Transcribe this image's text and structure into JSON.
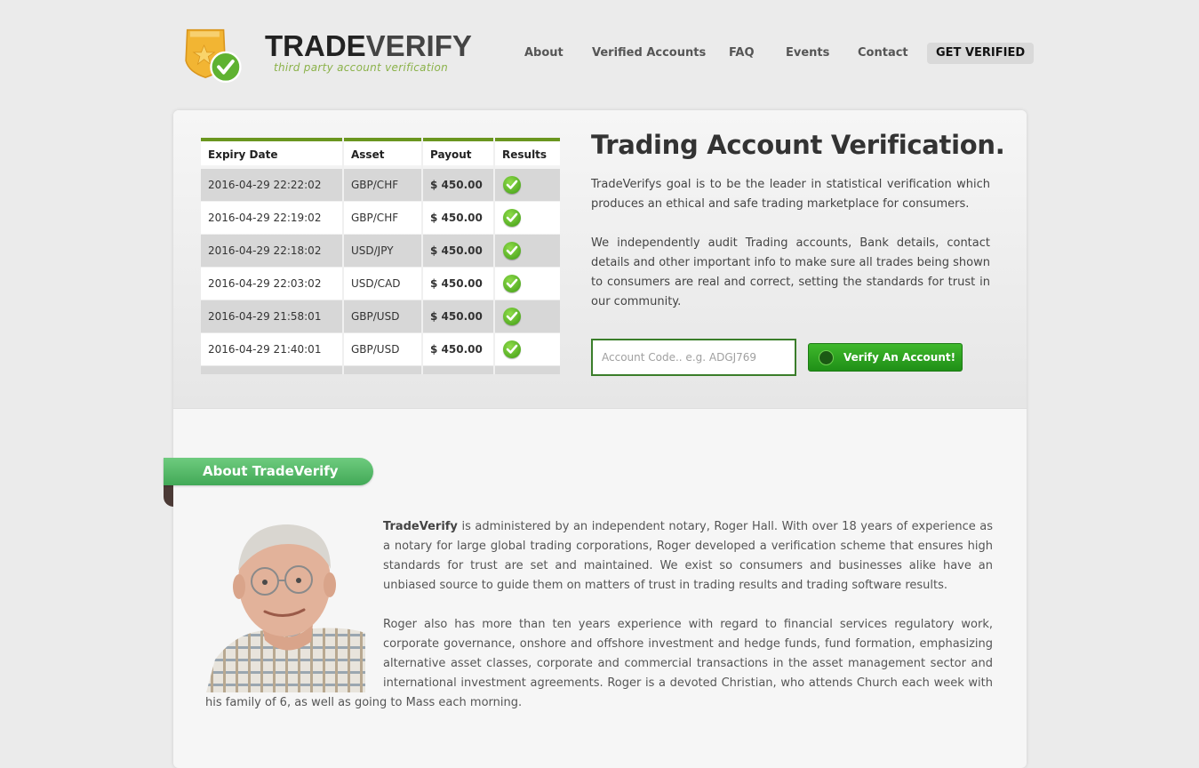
{
  "header": {
    "logo_word_bold": "TRADE",
    "logo_word_light": "VERIFY",
    "logo_tagline": "third party account verification",
    "nav": [
      {
        "label": "About"
      },
      {
        "label": "Verified Accounts"
      },
      {
        "label": "FAQ"
      },
      {
        "label": "Events"
      },
      {
        "label": "Contact"
      },
      {
        "label": "GET VERIFIED"
      }
    ]
  },
  "results_table": {
    "columns": [
      "Expiry Date",
      "Asset",
      "Payout",
      "Results"
    ],
    "rows": [
      {
        "date": "2016-04-29 22:22:02",
        "asset": "GBP/CHF",
        "payout": "$ 450.00",
        "result": "check-icon"
      },
      {
        "date": "2016-04-29 22:19:02",
        "asset": "GBP/CHF",
        "payout": "$ 450.00",
        "result": "check-icon"
      },
      {
        "date": "2016-04-29 22:18:02",
        "asset": "USD/JPY",
        "payout": "$ 450.00",
        "result": "check-icon"
      },
      {
        "date": "2016-04-29 22:03:02",
        "asset": "USD/CAD",
        "payout": "$ 450.00",
        "result": "check-icon"
      },
      {
        "date": "2016-04-29 21:58:01",
        "asset": "GBP/USD",
        "payout": "$ 450.00",
        "result": "check-icon"
      },
      {
        "date": "2016-04-29 21:40:01",
        "asset": "GBP/USD",
        "payout": "$ 450.00",
        "result": "check-icon"
      }
    ]
  },
  "hero": {
    "title": "Trading Account Verification.",
    "paragraph1": "TradeVerifys goal is to be the leader in statistical verification which produces an ethical and safe trading marketplace for consumers.",
    "paragraph2": "We independently audit Trading accounts, Bank details, contact details and other important info to make sure all trades being shown to consumers are real and correct, setting the standards for trust in our community.",
    "account_placeholder": "Account Code.. e.g. ADGJ769",
    "verify_button": "Verify An Account!"
  },
  "about": {
    "heading": "About TradeVerify",
    "p1_bold": "TradeVerify",
    "p1_rest": " is administered by an independent notary, Roger Hall. With over 18 years of experience as a notary for large global trading corporations, Roger developed a verification scheme that ensures high standards for trust are set and maintained. We exist so consumers and businesses alike have an unbiased source to guide them on matters of trust in trading results and trading software results.",
    "p2": "Roger also has more than ten years experience with regard to financial services regulatory work, corporate governance, onshore and offshore investment and hedge funds, fund formation, emphasizing alternative asset classes, corporate and commercial transactions in the asset management sector and international investment agreements. Roger is a devoted Christian, who attends Church each week with his family of 6, as well as going to Mass each morning."
  },
  "colors": {
    "brand_green": "#6a961f",
    "button_green": "#2aa11f",
    "ribbon_green": "#52b466",
    "logo_gold": "#f2b533"
  }
}
